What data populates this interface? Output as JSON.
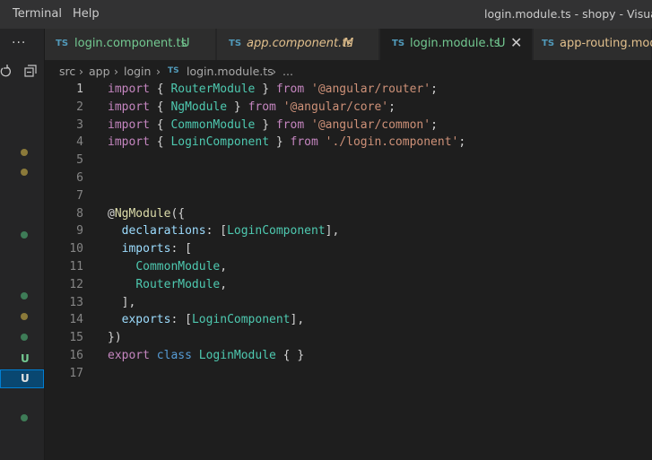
{
  "menu": {
    "items": [
      "Terminal",
      "Help"
    ]
  },
  "window_title": "login.module.ts - shopy - Visual St",
  "explorer": {
    "more_label": "···"
  },
  "tabs": [
    {
      "name": "login.component.ts",
      "status": "U",
      "name_color": "#73c991",
      "status_color": "#73c991",
      "italic": false,
      "active": false
    },
    {
      "name": "app.component.ts",
      "status": "M",
      "name_color": "#e2c08d",
      "status_color": "#e2c08d",
      "italic": true,
      "active": false
    },
    {
      "name": "login.module.ts",
      "status": "U",
      "name_color": "#73c991",
      "status_color": "#73c991",
      "italic": false,
      "active": true,
      "close": "✕"
    },
    {
      "name": "app-routing.mod",
      "status": "",
      "name_color": "#e2c08d",
      "status_color": "#e2c08d",
      "italic": false,
      "active": false
    }
  ],
  "tab_icon_label": "TS",
  "breadcrumb": [
    "src",
    "app",
    "login",
    "login.module.ts",
    "..."
  ],
  "git_decorations": {
    "untracked_letter": "U"
  },
  "editor": {
    "current_line": 1,
    "lines": [
      {
        "n": "1",
        "tokens": [
          [
            "kw",
            "import"
          ],
          [
            "punc",
            " { "
          ],
          [
            "ident",
            "RouterModule"
          ],
          [
            "punc",
            " } "
          ],
          [
            "kw",
            "from"
          ],
          [
            "punc",
            " "
          ],
          [
            "str",
            "'@angular/router'"
          ],
          [
            "punc",
            ";"
          ]
        ]
      },
      {
        "n": "2",
        "tokens": [
          [
            "kw",
            "import"
          ],
          [
            "punc",
            " { "
          ],
          [
            "ident",
            "NgModule"
          ],
          [
            "punc",
            " } "
          ],
          [
            "kw",
            "from"
          ],
          [
            "punc",
            " "
          ],
          [
            "str",
            "'@angular/core'"
          ],
          [
            "punc",
            ";"
          ]
        ]
      },
      {
        "n": "3",
        "tokens": [
          [
            "kw",
            "import"
          ],
          [
            "punc",
            " { "
          ],
          [
            "ident",
            "CommonModule"
          ],
          [
            "punc",
            " } "
          ],
          [
            "kw",
            "from"
          ],
          [
            "punc",
            " "
          ],
          [
            "str",
            "'@angular/common'"
          ],
          [
            "punc",
            ";"
          ]
        ]
      },
      {
        "n": "4",
        "tokens": [
          [
            "kw",
            "import"
          ],
          [
            "punc",
            " { "
          ],
          [
            "ident",
            "LoginComponent"
          ],
          [
            "punc",
            " } "
          ],
          [
            "kw",
            "from"
          ],
          [
            "punc",
            " "
          ],
          [
            "str",
            "'./login.component'"
          ],
          [
            "punc",
            ";"
          ]
        ]
      },
      {
        "n": "5",
        "tokens": []
      },
      {
        "n": "6",
        "tokens": []
      },
      {
        "n": "7",
        "tokens": []
      },
      {
        "n": "8",
        "tokens": [
          [
            "punc",
            "@"
          ],
          [
            "deco",
            "NgModule"
          ],
          [
            "punc",
            "({"
          ]
        ]
      },
      {
        "n": "9",
        "tokens": [
          [
            "punc",
            "  "
          ],
          [
            "prop",
            "declarations"
          ],
          [
            "punc",
            ": ["
          ],
          [
            "ident",
            "LoginComponent"
          ],
          [
            "punc",
            "],"
          ]
        ]
      },
      {
        "n": "10",
        "tokens": [
          [
            "punc",
            "  "
          ],
          [
            "prop",
            "imports"
          ],
          [
            "punc",
            ": ["
          ]
        ]
      },
      {
        "n": "11",
        "tokens": [
          [
            "punc",
            "    "
          ],
          [
            "ident",
            "CommonModule"
          ],
          [
            "punc",
            ","
          ]
        ]
      },
      {
        "n": "12",
        "tokens": [
          [
            "punc",
            "    "
          ],
          [
            "ident",
            "RouterModule"
          ],
          [
            "punc",
            ","
          ]
        ]
      },
      {
        "n": "13",
        "tokens": [
          [
            "punc",
            "  ],"
          ]
        ]
      },
      {
        "n": "14",
        "tokens": [
          [
            "punc",
            "  "
          ],
          [
            "prop",
            "exports"
          ],
          [
            "punc",
            ": ["
          ],
          [
            "ident",
            "LoginComponent"
          ],
          [
            "punc",
            "],"
          ]
        ]
      },
      {
        "n": "15",
        "tokens": [
          [
            "punc",
            "})"
          ]
        ]
      },
      {
        "n": "16",
        "tokens": [
          [
            "kw",
            "export"
          ],
          [
            "punc",
            " "
          ],
          [
            "kw2",
            "class"
          ],
          [
            "punc",
            " "
          ],
          [
            "ident",
            "LoginModule"
          ],
          [
            "punc",
            " { }"
          ]
        ]
      },
      {
        "n": "17",
        "tokens": []
      }
    ]
  }
}
